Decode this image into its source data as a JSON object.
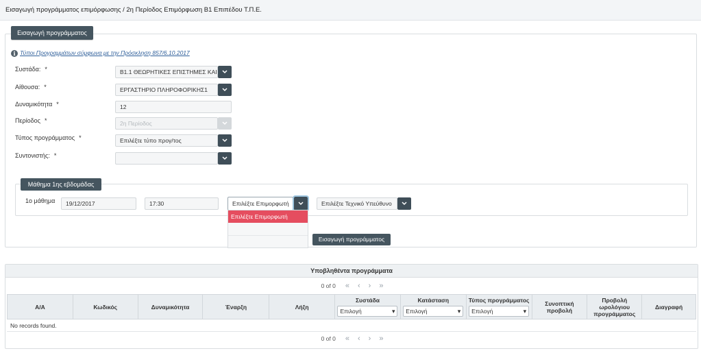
{
  "header": {
    "title": "Εισαγωγή προγράμματος επιμόρφωσης / 2η Περίοδος Επιμόρφωση Β1 Επιπέδου Τ.Π.Ε."
  },
  "form": {
    "section_button": "Εισαγωγή προγράμματος",
    "info_link": "Τύποι Προγραμμάτων σύμφωνα με την Πρόσκληση 857/6.10.2017",
    "required_mark": "*",
    "fields": {
      "systada": {
        "label": "Συστάδα:",
        "value": "Β1.1 ΘΕΩΡΗΤΙΚΕΣ ΕΠΙΣΤΗΜΕΣ ΚΑΙ Κ"
      },
      "aithousa": {
        "label": "Αίθουσα:",
        "value": "ΕΡΓΑΣΤΗΡΙΟ ΠΛΗΡΟΦΟΡΙΚΗΣ1"
      },
      "dynamikotita": {
        "label": "Δυναμικότητα",
        "value": "12"
      },
      "periodos": {
        "label": "Περίοδος",
        "value": "2η Περίοδος"
      },
      "typos": {
        "label": "Τύπος προγράμματος",
        "value": "Επιλέξτε τύπο προγ/τος"
      },
      "syntonistis": {
        "label": "Συντονιστής:",
        "value": ""
      }
    }
  },
  "week": {
    "button": "Μάθημα 1ης εβδομάδας",
    "lesson_label": "1ο μάθημα",
    "date": "19/12/2017",
    "time": "17:30",
    "trainer_select": "Επιλέξτε Επιμορφωτή",
    "tech_select": "Επιλέξτε Τεχνικό Υπεύθυνο",
    "dropdown_option": "Επιλέξτε Επιμορφωτή"
  },
  "submit_button": "Εισαγωγή προγράμματος",
  "grid": {
    "title": "Υποβληθέντα προγράμματα",
    "page_info": "0 of 0",
    "columns": [
      "Α/Α",
      "Κωδικός",
      "Δυναμικότητα",
      "Έναρξη",
      "Λήξη",
      "Συστάδα",
      "Κατάσταση",
      "Τύπος προγράμματος",
      "Συνοπτική προβολή",
      "Προβολή ωρολόγιου προγράμματος",
      "Διαγραφή"
    ],
    "filter_placeholder": "Επιλογή",
    "empty_message": "No records found."
  },
  "colors": {
    "dark": "#45555f",
    "highlight": "#e54d5f",
    "link": "#2f5f9a"
  },
  "icons": [
    "info-icon",
    "chevron-down-icon",
    "first-page-icon",
    "prev-page-icon",
    "next-page-icon",
    "last-page-icon"
  ]
}
